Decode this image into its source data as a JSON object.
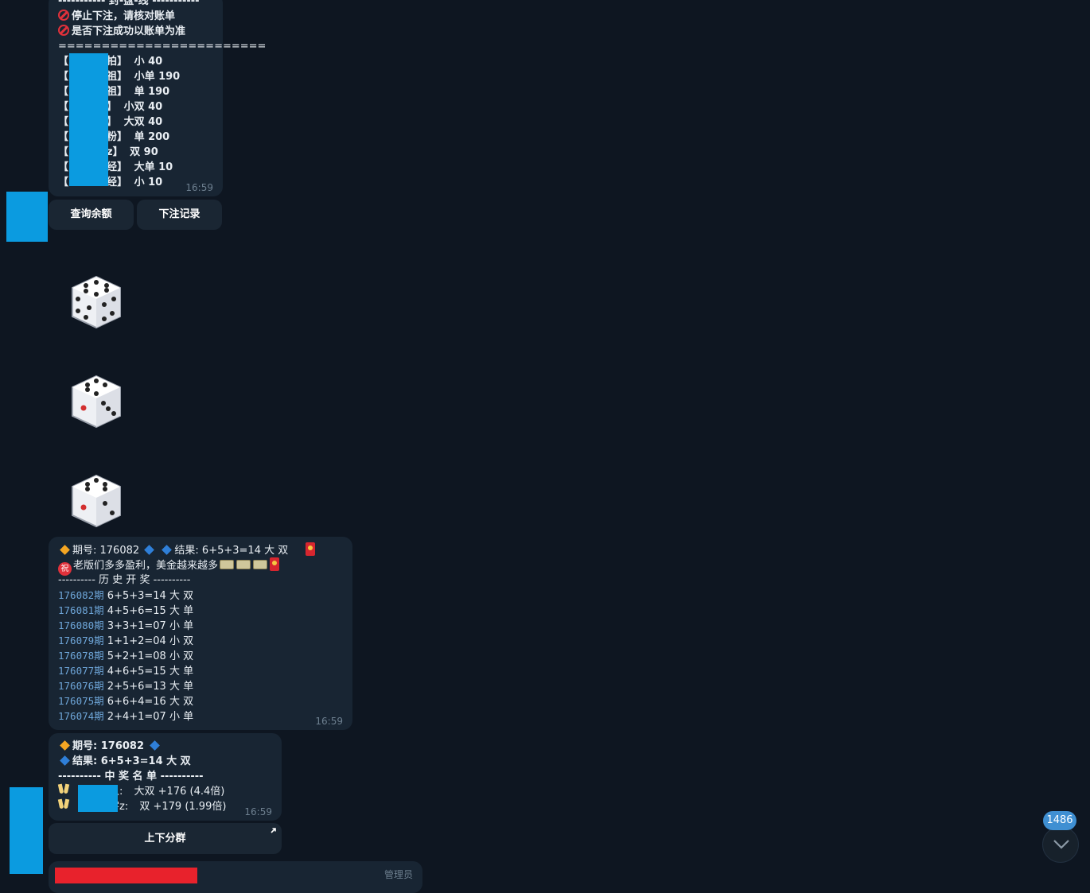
{
  "bet_summary": {
    "header_line": "----------- 封-盘-线 -----------",
    "warn1": "停止下注，请核对账单",
    "warn2": "是否下注成功以账单为准",
    "separator": "========================",
    "bets": [
      {
        "name": "拍】",
        "bet": "小 40"
      },
      {
        "name": "祖】",
        "bet": "小单 190"
      },
      {
        "name": "祖】",
        "bet": "单 190"
      },
      {
        "name": "】",
        "bet": "小双 40"
      },
      {
        "name": "】",
        "bet": "大双 40"
      },
      {
        "name": "粉】",
        "bet": "单 200"
      },
      {
        "name": "z】",
        "bet": "双 90"
      },
      {
        "name": "经】",
        "bet": "大单 10"
      },
      {
        "name": "经】",
        "bet": "小 10"
      }
    ],
    "time": "16:59",
    "buttons": {
      "balance": "查询余额",
      "records": "下注记录"
    }
  },
  "dice": [
    {
      "name": "dice-six-sticker",
      "value": 6
    },
    {
      "name": "dice-five-sticker",
      "value": 5
    },
    {
      "name": "dice-three-sticker",
      "value": 3
    }
  ],
  "result": {
    "line1_prefix": "期号:  176082",
    "line1_result": "结果: 6+5+3=14  大  双",
    "line2_zhu": "祝",
    "line2_text": "老版们多多盈利，美金越来越多",
    "history_header": "---------- 历 史 开 奖 ----------",
    "history": [
      {
        "period": "176082期",
        "result": "6+5+3=14 大  双"
      },
      {
        "period": "176081期",
        "result": "4+5+6=15 大  单"
      },
      {
        "period": "176080期",
        "result": "3+3+1=07 小  单"
      },
      {
        "period": "176079期",
        "result": "1+1+2=04 小  双"
      },
      {
        "period": "176078期",
        "result": "5+2+1=08 小  双"
      },
      {
        "period": "176077期",
        "result": "4+6+5=15 大  单"
      },
      {
        "period": "176076期",
        "result": "2+5+6=13 大  单"
      },
      {
        "period": "176075期",
        "result": "6+6+4=16 大  双"
      },
      {
        "period": "176074期",
        "result": "2+4+1=07 小  单"
      }
    ],
    "time": "16:59"
  },
  "winners": {
    "period": "期号:  176082",
    "result": "结果: 6+5+3=14  大  双",
    "header": "---------- 中 奖 名 单 ----------",
    "list": [
      {
        "name": "人:",
        "detail": "大双   +176 (4.4倍)"
      },
      {
        "name": "字z:",
        "detail": "双   +179 (1.99倍)"
      }
    ],
    "time": "16:59",
    "button": "上下分群"
  },
  "partial_next": {
    "label": "管理员"
  },
  "unread_count": "1486",
  "colors": {
    "background": "#0e1621",
    "bubble": "#182533",
    "accent": "#3f8fd2",
    "link": "#6ea6d9"
  }
}
